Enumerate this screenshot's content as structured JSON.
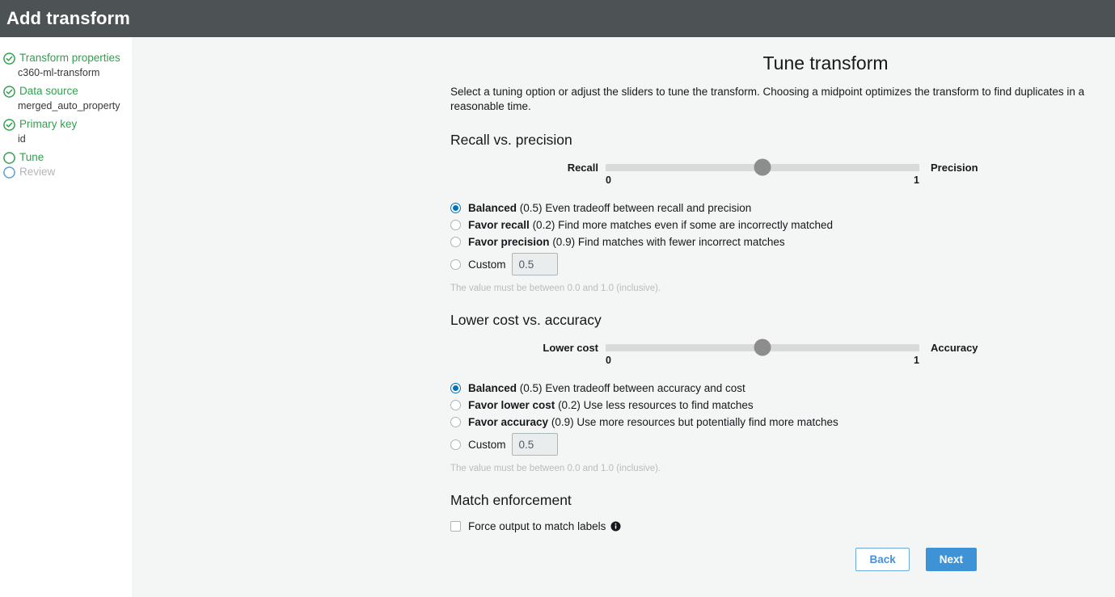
{
  "header": {
    "title": "Add transform"
  },
  "sidebar": {
    "steps": [
      {
        "label": "Transform properties",
        "sub": "c360-ml-transform",
        "state": "done",
        "icon": "check-circle-icon"
      },
      {
        "label": "Data source",
        "sub": "merged_auto_property",
        "state": "done",
        "icon": "check-circle-icon"
      },
      {
        "label": "Primary key",
        "sub": "id",
        "state": "done",
        "icon": "check-circle-icon"
      },
      {
        "label": "Tune",
        "sub": "",
        "state": "current",
        "icon": "circle-icon"
      },
      {
        "label": "Review",
        "sub": "",
        "state": "upcoming",
        "icon": "circle-icon"
      }
    ]
  },
  "main": {
    "page_title": "Tune transform",
    "description": "Select a tuning option or adjust the sliders to tune the transform. Choosing a midpoint optimizes the transform to find duplicates in a reasonable time.",
    "sections": [
      {
        "title": "Recall vs. precision",
        "slider": {
          "left_label": "Recall",
          "right_label": "Precision",
          "min_tick": "0",
          "max_tick": "1",
          "value": 0.5
        },
        "options": [
          {
            "name": "Balanced",
            "value": "(0.5)",
            "desc": "Even tradeoff between recall and precision",
            "selected": true
          },
          {
            "name": "Favor recall",
            "value": "(0.2)",
            "desc": "Find more matches even if some are incorrectly matched",
            "selected": false
          },
          {
            "name": "Favor precision",
            "value": "(0.9)",
            "desc": "Find matches with fewer incorrect matches",
            "selected": false
          }
        ],
        "custom": {
          "label": "Custom",
          "input_value": "0.5",
          "selected": false
        },
        "helper_text": "The value must be between 0.0 and 1.0 (inclusive)."
      },
      {
        "title": "Lower cost vs. accuracy",
        "slider": {
          "left_label": "Lower cost",
          "right_label": "Accuracy",
          "min_tick": "0",
          "max_tick": "1",
          "value": 0.5
        },
        "options": [
          {
            "name": "Balanced",
            "value": "(0.5)",
            "desc": "Even tradeoff between accuracy and cost",
            "selected": true
          },
          {
            "name": "Favor lower cost",
            "value": "(0.2)",
            "desc": "Use less resources to find matches",
            "selected": false
          },
          {
            "name": "Favor accuracy",
            "value": "(0.9)",
            "desc": "Use more resources but potentially find more matches",
            "selected": false
          }
        ],
        "custom": {
          "label": "Custom",
          "input_value": "0.5",
          "selected": false
        },
        "helper_text": "The value must be between 0.0 and 1.0 (inclusive)."
      }
    ],
    "match_enforcement": {
      "title": "Match enforcement",
      "checkbox_label": "Force output to match labels",
      "checked": false,
      "info_icon": "info-icon"
    },
    "footer": {
      "back_label": "Back",
      "next_label": "Next"
    }
  },
  "colors": {
    "header_bg": "#4d5255",
    "page_bg": "#f4f5f5",
    "sidebar_bg": "#ffffff",
    "step_done": "#30a14e",
    "step_upcoming": "#b5b5b5",
    "radio_accent": "#0073bb",
    "primary_button": "#3d93d6",
    "link_blue": "#4a90d9",
    "slider_track": "#dadada",
    "slider_thumb": "#8d8d8d"
  }
}
